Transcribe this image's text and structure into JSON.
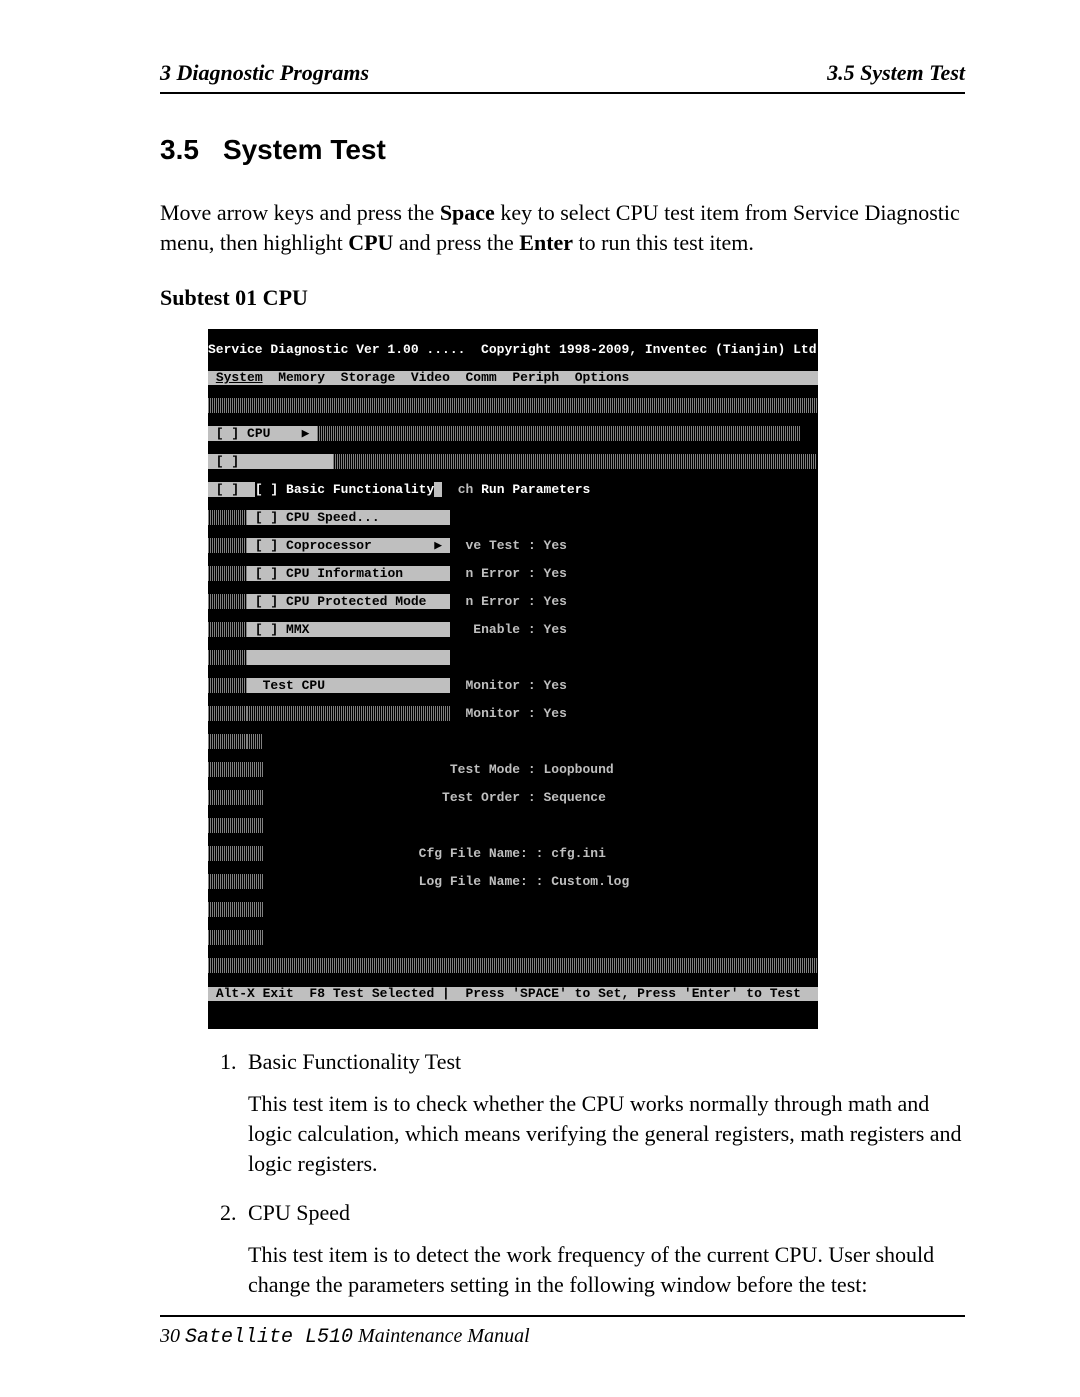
{
  "header": {
    "left": "3  Diagnostic Programs",
    "right": "3.5 System Test"
  },
  "section": {
    "number": "3.5",
    "title": "System Test"
  },
  "intro": {
    "pre": "Move arrow keys and press the ",
    "space": "Space",
    "mid": " key to select CPU test item from Service Diagnostic menu, then highlight ",
    "cpu": "CPU",
    "mid2": " and press the ",
    "enter": "Enter",
    "post": " to run this test item."
  },
  "subtest": "Subtest 01 CPU",
  "dos": {
    "titlebar": "Service Diagnostic Ver 1.00 .....  Copyright 1998-2009, Inventec (Tianjin) Ltd.",
    "menubar": {
      "items": [
        "System",
        "Memory",
        "Storage",
        "Video",
        "Comm",
        "Periph",
        "Options"
      ]
    },
    "left_selected": "CPU",
    "submenu": {
      "items": [
        {
          "mark": "[ ]",
          "label": "Basic Functionality",
          "arrow": false,
          "hi": true
        },
        {
          "mark": "[ ]",
          "label": "CPU Speed...",
          "arrow": false,
          "hi": false
        },
        {
          "mark": "[ ]",
          "label": "Coprocessor",
          "arrow": true,
          "hi": false
        },
        {
          "mark": "[ ]",
          "label": "CPU Information",
          "arrow": false,
          "hi": false
        },
        {
          "mark": "[ ]",
          "label": "CPU Protected Mode",
          "arrow": false,
          "hi": false
        },
        {
          "mark": "[ ]",
          "label": "MMX",
          "arrow": false,
          "hi": false
        }
      ],
      "footer": "Test CPU"
    },
    "panel": {
      "title": "Run Parameters",
      "rows": [
        "ve Test : Yes",
        "n Error : Yes",
        "n Error : Yes",
        " Enable : Yes",
        "",
        "Monitor : Yes",
        "Monitor : Yes"
      ],
      "extra": [
        " Test Mode : Loopbound",
        "Test Order : Sequence",
        "",
        "Cfg File Name: : cfg.ini",
        "Log File Name: : Custom.log"
      ]
    },
    "footer": "Alt-X Exit  F8 Test Selected |  Press 'SPACE' to Set, Press 'Enter' to Test"
  },
  "list": {
    "item1": {
      "num": "1.",
      "title": "Basic Functionality Test",
      "desc": "This test item is to check whether the CPU works normally through math and logic calculation, which means verifying the general registers, math registers and logic registers."
    },
    "item2": {
      "num": "2.",
      "title": "CPU Speed",
      "desc": "This test item is to detect the work frequency of the current CPU. User should change the parameters setting in the following window before the test:"
    }
  },
  "footer": {
    "page": "30",
    "model": "Satellite L510",
    "tail": " Maintenance Manual"
  }
}
